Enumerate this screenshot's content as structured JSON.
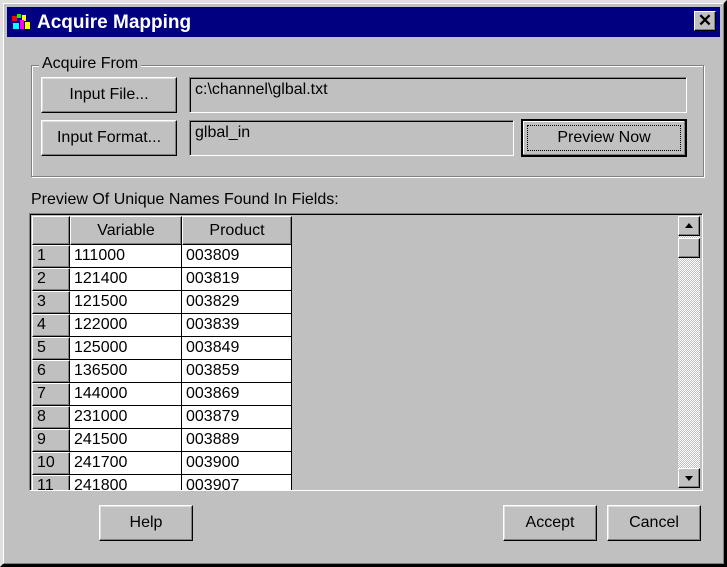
{
  "window": {
    "title": "Acquire Mapping",
    "close_glyph": "✕"
  },
  "acquire_from": {
    "group_label": "Acquire From",
    "input_file_button": "Input File...",
    "input_file_value": "c:\\channel\\glbal.txt",
    "input_format_button": "Input Format...",
    "input_format_value": "glbal_in",
    "preview_now_button": "Preview Now"
  },
  "preview": {
    "label": "Preview Of Unique Names Found In Fields:",
    "columns": [
      "Variable",
      "Product"
    ],
    "rows": [
      {
        "num": "1",
        "variable": "111000",
        "product": "003809"
      },
      {
        "num": "2",
        "variable": "121400",
        "product": "003819"
      },
      {
        "num": "3",
        "variable": "121500",
        "product": "003829"
      },
      {
        "num": "4",
        "variable": "122000",
        "product": "003839"
      },
      {
        "num": "5",
        "variable": "125000",
        "product": "003849"
      },
      {
        "num": "6",
        "variable": "136500",
        "product": "003859"
      },
      {
        "num": "7",
        "variable": "144000",
        "product": "003869"
      },
      {
        "num": "8",
        "variable": "231000",
        "product": "003879"
      },
      {
        "num": "9",
        "variable": "241500",
        "product": "003889"
      },
      {
        "num": "10",
        "variable": "241700",
        "product": "003900"
      },
      {
        "num": "11",
        "variable": "241800",
        "product": "003907"
      }
    ]
  },
  "buttons": {
    "help": "Help",
    "accept": "Accept",
    "cancel": "Cancel"
  },
  "colors": {
    "titlebar": "#000080",
    "face": "#c0c0c0"
  },
  "icons": [
    "app-icon",
    "close-icon",
    "scroll-up-icon",
    "scroll-down-icon"
  ]
}
